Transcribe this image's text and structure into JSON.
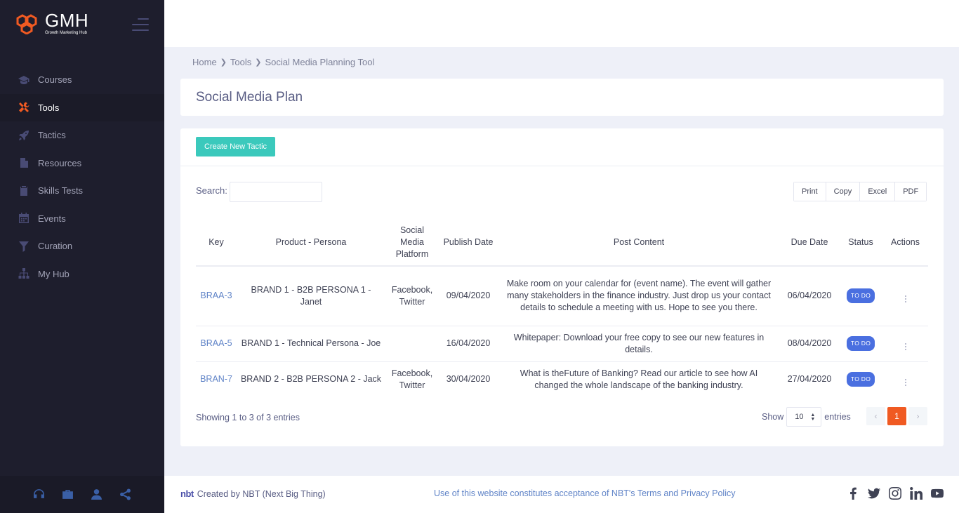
{
  "brand": {
    "title": "GMH",
    "subtitle": "Growth Marketing Hub",
    "accent_color": "#f05a22"
  },
  "sidebar": {
    "items": [
      {
        "label": "Courses",
        "icon": "graduation-cap-icon",
        "active": false
      },
      {
        "label": "Tools",
        "icon": "tools-icon",
        "active": true
      },
      {
        "label": "Tactics",
        "icon": "rocket-icon",
        "active": false
      },
      {
        "label": "Resources",
        "icon": "file-icon",
        "active": false
      },
      {
        "label": "Skills Tests",
        "icon": "clipboard-check-icon",
        "active": false
      },
      {
        "label": "Events",
        "icon": "calendar-icon",
        "active": false
      },
      {
        "label": "Curation",
        "icon": "filter-icon",
        "active": false
      },
      {
        "label": "My Hub",
        "icon": "sitemap-icon",
        "active": false
      }
    ],
    "footer_icons": [
      "headset-icon",
      "briefcase-icon",
      "user-icon",
      "share-icon"
    ]
  },
  "breadcrumb": {
    "items": [
      "Home",
      "Tools",
      "Social Media Planning Tool"
    ]
  },
  "page": {
    "title": "Social Media Plan"
  },
  "toolbar": {
    "create_label": "Create New Tactic",
    "search_label": "Search:",
    "search_value": "",
    "export": {
      "print": "Print",
      "copy": "Copy",
      "excel": "Excel",
      "pdf": "PDF"
    }
  },
  "table": {
    "headers": {
      "key": "Key",
      "product": "Product - Persona",
      "platform": "Social Media Platform",
      "publish": "Publish Date",
      "post": "Post Content",
      "due": "Due Date",
      "status": "Status",
      "actions": "Actions"
    },
    "rows": [
      {
        "key": "BRAA-3",
        "product": "BRAND 1 - B2B PERSONA 1 - Janet",
        "platform": "Facebook, Twitter",
        "publish": "09/04/2020",
        "post": "Make room on your calendar for (event name). The event will gather many stakeholders in the finance industry. Just drop us your contact details to schedule a meeting with us. Hope to see you there.",
        "due": "06/04/2020",
        "status": "TO DO"
      },
      {
        "key": "BRAA-5",
        "product": "BRAND 1 - Technical Persona - Joe",
        "platform": "",
        "publish": "16/04/2020",
        "post": "Whitepaper: Download your free copy to see our new features in details.",
        "due": "08/04/2020",
        "status": "TO DO"
      },
      {
        "key": "BRAN-7",
        "product": "BRAND 2 - B2B PERSONA 2 - Jack",
        "platform": "Facebook, Twitter",
        "publish": "30/04/2020",
        "post": "What is theFuture of Banking? Read our article to see how AI changed the whole landscape of the banking industry.",
        "due": "27/04/2020",
        "status": "TO DO"
      }
    ]
  },
  "pagination": {
    "info": "Showing 1 to 3 of 3 entries",
    "show_label": "Show",
    "page_size": "10",
    "entries_label": "entries",
    "current_page": "1",
    "prev": "‹",
    "next": "›"
  },
  "footer": {
    "logo": "nbt",
    "created_by": "Created by",
    "company": "NBT (Next Big Thing)",
    "notice_prefix": "Use of this website constitutes acceptance of NBT's",
    "terms": "Terms",
    "and": "and",
    "privacy": "Privacy Policy",
    "social_icons": [
      "facebook-icon",
      "twitter-icon",
      "instagram-icon",
      "linkedin-icon",
      "youtube-icon"
    ]
  }
}
